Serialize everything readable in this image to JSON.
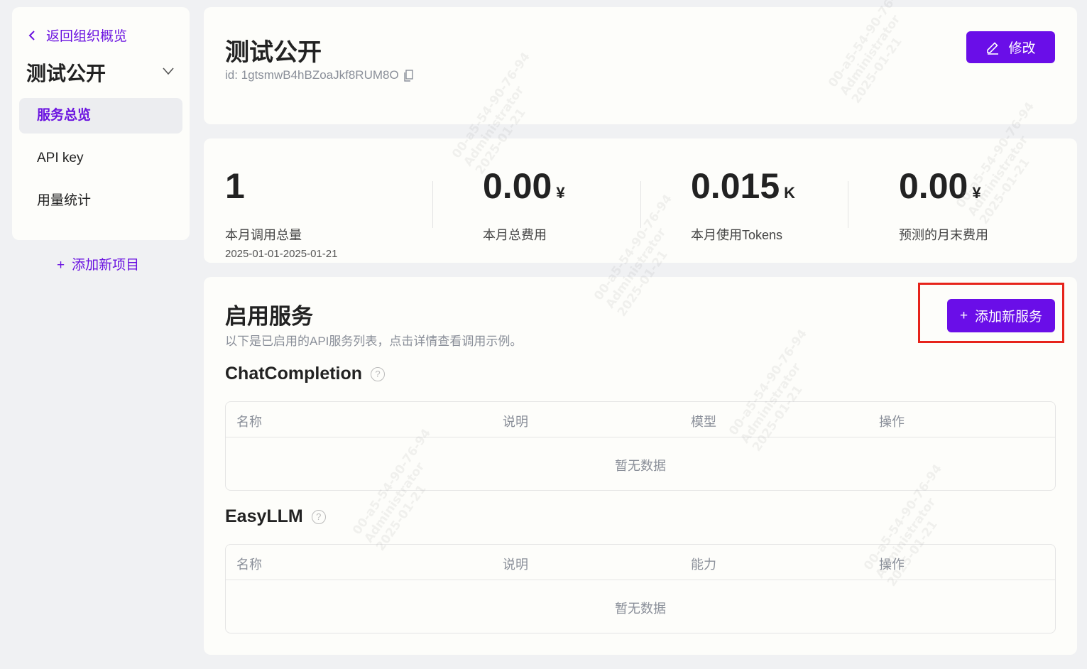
{
  "sidebar": {
    "back_label": "返回组织概览",
    "project_name": "测试公开",
    "items": [
      {
        "label": "服务总览",
        "active": true
      },
      {
        "label": "API key",
        "active": false
      },
      {
        "label": "用量统计",
        "active": false
      }
    ],
    "add_project": "添加新项目",
    "add_project_icon": "+"
  },
  "header": {
    "title": "测试公开",
    "id_text": "id: 1gtsmwB4hBZoaJkf8RUM8O",
    "edit_label": "修改"
  },
  "stats": [
    {
      "value": "1",
      "unit": "",
      "label": "本月调用总量",
      "sub": "2025-01-01-2025-01-21"
    },
    {
      "value": "0.00",
      "unit": "¥",
      "label": "本月总费用",
      "sub": ""
    },
    {
      "value": "0.015",
      "unit": "K",
      "label": "本月使用Tokens",
      "sub": ""
    },
    {
      "value": "0.00",
      "unit": "¥",
      "label": "预测的月末费用",
      "sub": ""
    }
  ],
  "services": {
    "title": "启用服务",
    "description": "以下是已启用的API服务列表，点击详情查看调用示例。",
    "add_label": "添加新服务",
    "add_icon": "+",
    "help_icon": "?",
    "sections": [
      {
        "name": "ChatCompletion",
        "columns": [
          "名称",
          "说明",
          "模型",
          "操作"
        ],
        "empty": "暂无数据"
      },
      {
        "name": "EasyLLM",
        "columns": [
          "名称",
          "说明",
          "能力",
          "操作"
        ],
        "empty": "暂无数据"
      }
    ]
  },
  "watermark": "00-a5-54-90-76-94\nAdministrator\n2025-01-21",
  "colors": {
    "accent": "#6a0ee8",
    "highlight": "#e6231b",
    "background": "#f0f1f3"
  }
}
